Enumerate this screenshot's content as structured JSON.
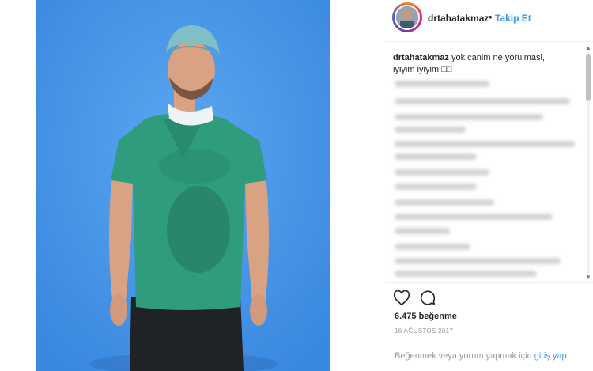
{
  "post": {
    "username": "drtahatakmaz",
    "separator": "•",
    "follow_label": "Takip Et",
    "caption_user": "drtahatakmaz",
    "caption_text": "yok canim ne yorulmasi, iyiyim iyiyim □□",
    "likes": "6.475 beğenme",
    "date": "16 AĞUSTOS 2017",
    "login_prompt_text": "Beğenmek veya yorum yapmak için",
    "login_link": "giriş yap",
    "login_suffix": "."
  },
  "icons": {
    "like": "heart-icon",
    "comment": "comment-icon"
  },
  "colors": {
    "link": "#3897f0",
    "text": "#262626",
    "muted": "#999999",
    "photo_background": "#4a98ea",
    "scrubs": "#2e9a7a"
  }
}
